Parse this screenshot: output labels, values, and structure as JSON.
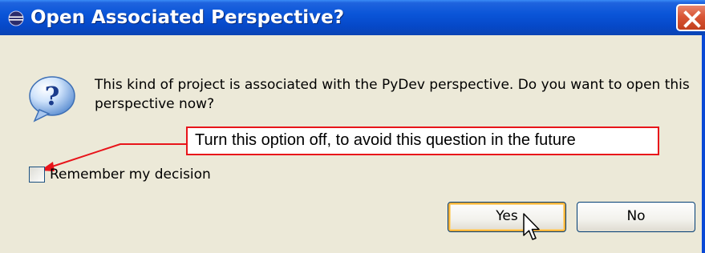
{
  "window": {
    "title": "Open Associated Perspective?",
    "title_icon": "eclipse-icon",
    "close_icon": "close-icon"
  },
  "message": {
    "icon": "question-icon",
    "text": "This kind of project is associated with the PyDev perspective.  Do you want to open this perspective now?"
  },
  "callout": {
    "text": "Turn this option off, to avoid this question in the future",
    "color": "#e8141a"
  },
  "checkbox": {
    "label": "Remember my decision",
    "checked": false
  },
  "buttons": {
    "yes_label": "Yes",
    "no_label": "No"
  },
  "colors": {
    "titlebar": "#0a55d8",
    "dialog_bg": "#ece9d8",
    "close": "#d95636"
  }
}
